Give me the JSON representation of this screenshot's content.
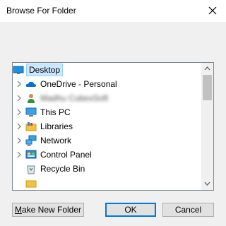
{
  "window": {
    "title": "Browse For Folder"
  },
  "tree": {
    "root": {
      "label": "Desktop",
      "icon": "desktop-icon"
    },
    "items": [
      {
        "label": "OneDrive - Personal",
        "icon": "onedrive-cloud-icon"
      },
      {
        "label": "Madhu CubexSoft",
        "icon": "user-folder-icon"
      },
      {
        "label": "This PC",
        "icon": "this-pc-icon"
      },
      {
        "label": "Libraries",
        "icon": "libraries-icon"
      },
      {
        "label": "Network",
        "icon": "network-icon"
      },
      {
        "label": "Control Panel",
        "icon": "control-panel-icon"
      },
      {
        "label": "Recycle Bin",
        "icon": "recycle-bin-icon"
      }
    ]
  },
  "buttons": {
    "make_new_folder_mnemonic": "M",
    "make_new_folder_rest": "ake New Folder",
    "ok": "OK",
    "cancel": "Cancel"
  },
  "colors": {
    "selection_fill": "#cce8ff",
    "selection_border": "#99d1ff",
    "default_button_border": "#0078d7"
  }
}
